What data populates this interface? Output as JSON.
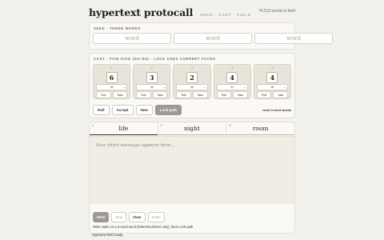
{
  "header": {
    "brand": "hypertext protocall",
    "tagline": "SEED · CAST · FIELD",
    "word_count": "74,513 words in field"
  },
  "seed": {
    "label": "SEED · THREE WORDS",
    "inputs": [
      {
        "placeholder": "word",
        "value": ""
      },
      {
        "placeholder": "word",
        "value": ""
      },
      {
        "placeholder": "word",
        "value": ""
      }
    ]
  },
  "cast": {
    "label": "CAST · FIVE DICE (D4–D6) · LOCK USES CURRENT FACES",
    "dice": [
      {
        "index": "1",
        "face": "6",
        "select": "d6",
        "roll": "Roll",
        "take": "Take"
      },
      {
        "index": "2",
        "face": "3",
        "select": "d6",
        "roll": "Roll",
        "take": "Take"
      },
      {
        "index": "3",
        "face": "2",
        "select": "d6",
        "roll": "Roll",
        "take": "Take"
      },
      {
        "index": "4",
        "face": "4",
        "select": "d4",
        "roll": "Roll",
        "take": "Take"
      },
      {
        "index": "5",
        "face": "4",
        "select": "d6",
        "roll": "Roll",
        "take": "Take"
      }
    ],
    "actions": {
      "roll": "Roll",
      "accept": "Accept",
      "new": "New",
      "lock_path": "Lock path"
    },
    "note": "need 3 seed words"
  },
  "editor": {
    "tabs": [
      {
        "index": "1",
        "label": "life"
      },
      {
        "index": "2",
        "label": "night"
      },
      {
        "index": "3",
        "label": "room"
      }
    ],
    "message_placeholder": "Your short message appears here…",
    "buttons": {
      "write": "Write",
      "stop": "Stop",
      "clear": "Clear",
      "share": "Share"
    },
    "hint": "Write waits on a 3-word seed (letters/numbers only), then Lock path."
  },
  "status": "Hypertext field ready."
}
